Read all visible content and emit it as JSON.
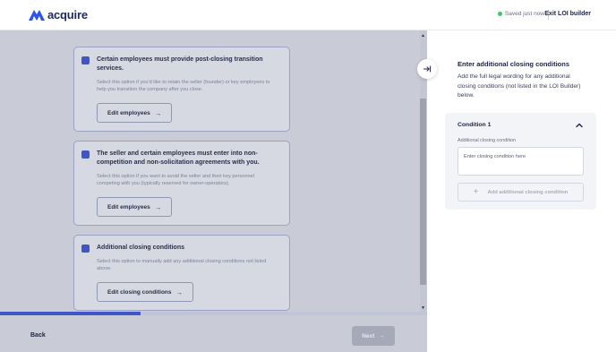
{
  "header": {
    "logo_text": "acquire",
    "saved_text": "Saved just now",
    "exit_label": "Exit LOI builder",
    "saved_dot_color": "#3fc36a"
  },
  "cards": [
    {
      "title": "Certain employees must provide post-closing transition services.",
      "description": "Select this option if you'd like to retain the seller (founder) or key employees to help you transition the company after you close.",
      "button_label": "Edit employees",
      "checked": true
    },
    {
      "title": "The seller and certain employees must enter into non-competition and non-solicitation agreements with you.",
      "description": "Select this option if you want to avoid the seller and their key personnel competing with you (typically reserved for owner-operators).",
      "button_label": "Edit employees",
      "checked": true
    },
    {
      "title": "Additional closing conditions",
      "description": "Select this option to manually add any additional closing conditions not listed above.",
      "button_label": "Edit closing conditions",
      "checked": true
    }
  ],
  "footer": {
    "back_label": "Back",
    "next_label": "Next",
    "progress_fraction": 0.33
  },
  "panel": {
    "title": "Enter additional closing conditions",
    "description": "Add the full legal wording for any additional closing conditions (not listed in the LOI Builder) below.",
    "condition": {
      "title": "Condition 1",
      "field_label": "Additional closing condition",
      "placeholder": "Enter closing condition here",
      "value": "",
      "add_label": "Add additional closing condition"
    }
  },
  "colors": {
    "accent": "#3f56c6",
    "brand": "#1d2a5b"
  },
  "icons": {
    "logo": "acquire-logo-icon",
    "collapse": "collapse-panel-icon",
    "chevron": "chevron-up-icon",
    "plus": "plus-icon",
    "arrow": "arrow-right-icon"
  }
}
